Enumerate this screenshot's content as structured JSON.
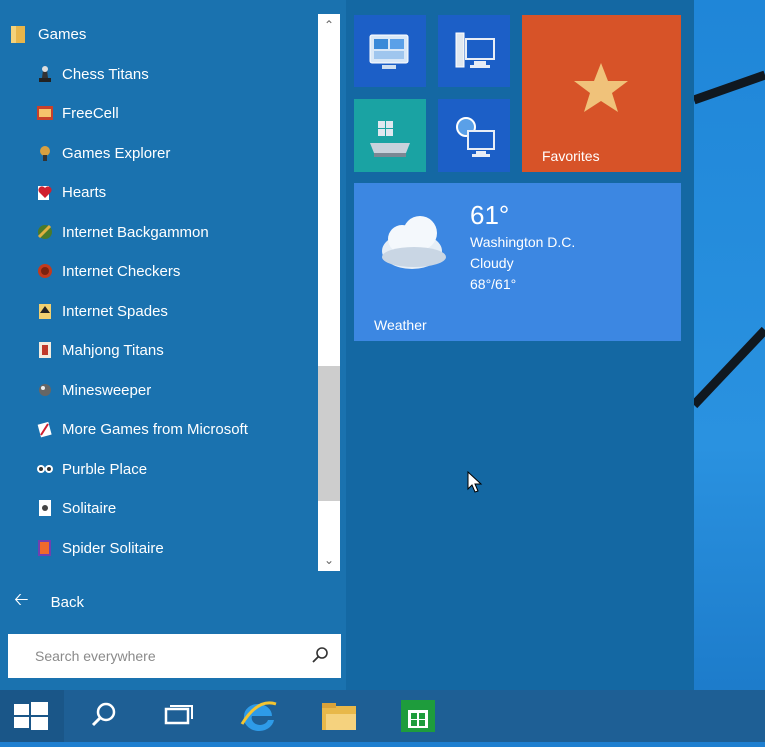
{
  "apps_list": {
    "folder": "Games",
    "items": [
      {
        "label": "Chess Titans",
        "icon": "chess-icon"
      },
      {
        "label": "FreeCell",
        "icon": "freecell-icon"
      },
      {
        "label": "Games Explorer",
        "icon": "games-explorer-icon"
      },
      {
        "label": "Hearts",
        "icon": "hearts-icon"
      },
      {
        "label": "Internet Backgammon",
        "icon": "backgammon-icon"
      },
      {
        "label": "Internet Checkers",
        "icon": "checkers-icon"
      },
      {
        "label": "Internet Spades",
        "icon": "spades-icon"
      },
      {
        "label": "Mahjong Titans",
        "icon": "mahjong-icon"
      },
      {
        "label": "Minesweeper",
        "icon": "minesweeper-icon"
      },
      {
        "label": "More Games from Microsoft",
        "icon": "more-games-icon"
      },
      {
        "label": "Purble Place",
        "icon": "purble-place-icon"
      },
      {
        "label": "Solitaire",
        "icon": "solitaire-icon"
      },
      {
        "label": "Spider Solitaire",
        "icon": "spider-solitaire-icon"
      }
    ]
  },
  "back_label": "Back",
  "search": {
    "placeholder": "Search everywhere"
  },
  "tiles": {
    "favorites_label": "Favorites",
    "weather": {
      "label": "Weather",
      "temperature": "61°",
      "city": "Washington D.C.",
      "condition": "Cloudy",
      "range": "68°/61°"
    }
  },
  "taskbar": {
    "items": [
      "start-icon",
      "search-icon",
      "task-view-icon",
      "internet-explorer-icon",
      "file-explorer-icon",
      "store-icon"
    ]
  },
  "colors": {
    "menu_bg": "#1468a3",
    "list_bg": "#1a72af",
    "favorites_tile": "#d75328",
    "weather_tile": "#3c87e2",
    "small_tile": "#1c5fc7",
    "drive_tile": "#1aa3a3",
    "taskbar": "#1e5f95"
  }
}
